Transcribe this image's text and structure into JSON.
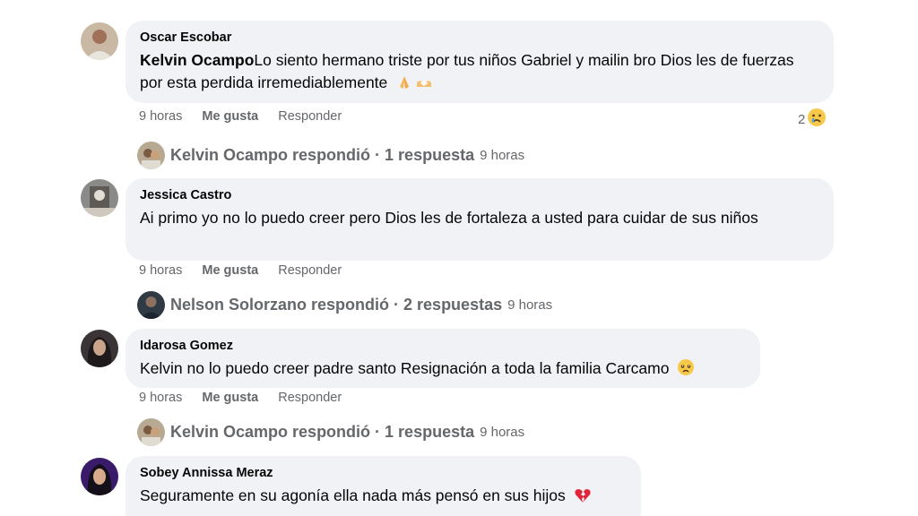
{
  "comments": [
    {
      "author": "Oscar Escobar",
      "mention": "Kelvin Ocampo",
      "text": "Lo siento hermano triste por tus niños Gabriel y mailin bro Dios les de fuerzas por esta perdida irremediablemente",
      "emojis": [
        "folded-hands",
        "heart-hands"
      ],
      "time": "9 horas",
      "like": "Me gusta",
      "reply": "Responder",
      "reaction_count": "2",
      "reaction_icon": "sad-face-icon",
      "replies": {
        "name": "Kelvin Ocampo respondió",
        "count": "· 1 respuesta",
        "time": "9 horas"
      }
    },
    {
      "author": "Jessica Castro",
      "text": "Ai primo yo no lo puedo creer pero Dios les de fortaleza a usted para cuidar de sus niños",
      "time": "9 horas",
      "like": "Me gusta",
      "reply": "Responder",
      "replies": {
        "name": "Nelson Solorzano respondió",
        "count": "· 2 respuestas",
        "time": "9 horas"
      }
    },
    {
      "author": "Idarosa Gomez",
      "text": "Kelvin no lo puedo creer padre santo Resignación a toda la familia Carcamo",
      "emojis": [
        "crying-face"
      ],
      "time": "9 horas",
      "like": "Me gusta",
      "reply": "Responder",
      "replies": {
        "name": "Kelvin Ocampo respondió",
        "count": "· 1 respuesta",
        "time": "9 horas"
      }
    },
    {
      "author": "Sobey Annissa Meraz",
      "text": "Seguramente en su agonía ella nada más pensó en sus hijos",
      "emojis": [
        "broken-heart"
      ]
    }
  ],
  "colors": {
    "bubble": "#f0f2f5",
    "meta": "#65676b",
    "text": "#050505"
  }
}
